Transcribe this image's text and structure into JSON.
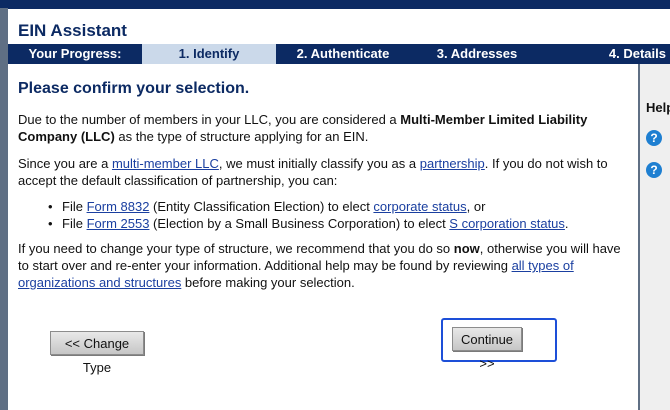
{
  "app": {
    "title": "EIN Assistant"
  },
  "progress": {
    "label": "Your Progress:",
    "steps": [
      {
        "label": "1. Identify",
        "active": true
      },
      {
        "label": "2. Authenticate",
        "active": false
      },
      {
        "label": "3. Addresses",
        "active": false
      },
      {
        "label": "4. Details",
        "active": false
      }
    ]
  },
  "main": {
    "heading": "Please confirm your selection.",
    "p1": {
      "text_before": "Due to the number of members in your LLC, you are considered a ",
      "bold": "Multi-Member Limited Liability Company (LLC)",
      "text_after": " as the type of structure applying for an EIN."
    },
    "p2": {
      "text1": "Since you are a ",
      "link1": "multi-member LLC",
      "text2": ", we must initially classify you as a ",
      "link2": "partnership",
      "text3": ".  If you do not wish to accept the default classification of partnership, you can:"
    },
    "bullets": [
      {
        "t1": "File ",
        "link1": "Form 8832",
        "t2": " (Entity Classification Election) to elect ",
        "link2": "corporate status",
        "t3": ", or"
      },
      {
        "t1": "File ",
        "link1": "Form 2553",
        "t2": " (Election by a Small Business Corporation) to elect ",
        "link2": "S corporation status",
        "t3": "."
      }
    ],
    "p3": {
      "text1": "If you need to change your type of structure, we recommend that you do so ",
      "bold": "now",
      "text2": ", otherwise you will have to start over and re-enter your information.  Additional help may be found by reviewing ",
      "link": "all types of organizations and structures",
      "text3": " before making your selection."
    }
  },
  "buttons": {
    "change_type": "<< Change Type",
    "continue": "Continue >>"
  },
  "sidebar": {
    "help_label": "Help"
  },
  "colors": {
    "navy": "#0c2a63",
    "active_step": "#cbd9ea",
    "link": "#1a3fa0",
    "highlight": "#1d4fd8"
  }
}
